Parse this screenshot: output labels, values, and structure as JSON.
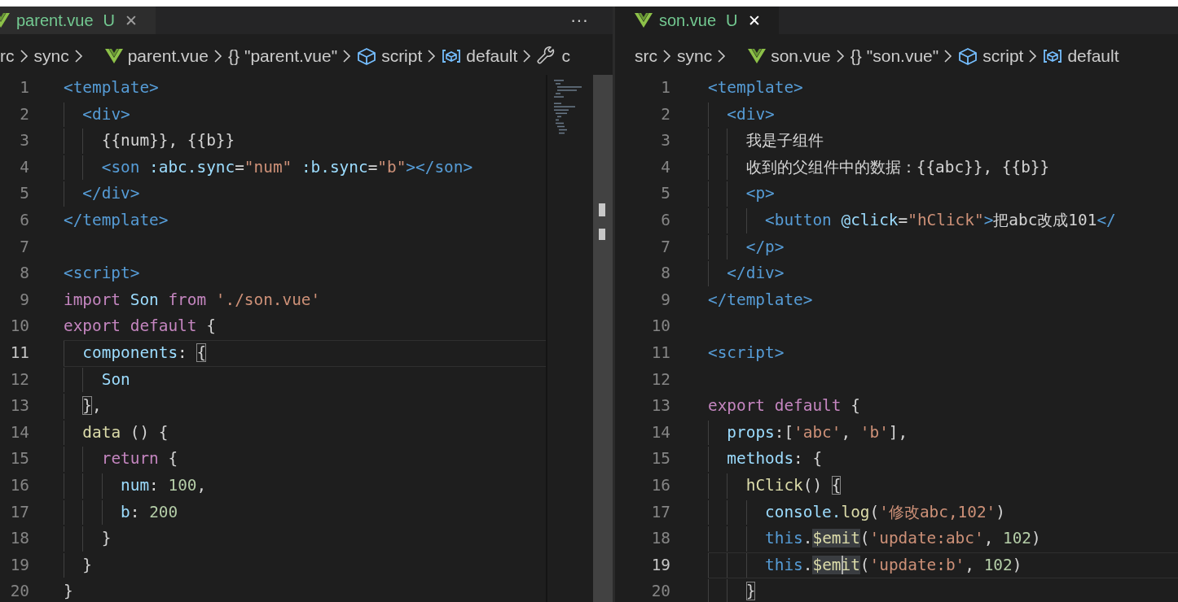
{
  "panes": [
    {
      "tab": {
        "label": "parent.vue",
        "badge": "U",
        "close": "✕",
        "selected": false
      },
      "more": "···",
      "breadcrumbs": [
        {
          "text": "rc",
          "kind": "folder"
        },
        {
          "text": "sync",
          "kind": "folder"
        },
        {
          "text": "parent.vue",
          "kind": "vue_file"
        },
        {
          "text": "\"parent.vue\"",
          "symbol": "{}",
          "kind": "module"
        },
        {
          "text": "script",
          "kind": "element"
        },
        {
          "text": "default",
          "kind": "variable"
        },
        {
          "text": "c",
          "kind": "property"
        }
      ],
      "lines": [
        {
          "number": "1",
          "current": false,
          "tokens": [
            {
              "text": "<template>",
              "kind": "tag"
            }
          ]
        },
        {
          "number": "2",
          "current": false,
          "tokens": [
            {
              "text": "  <div>",
              "kind": "tag"
            }
          ]
        },
        {
          "number": "3",
          "current": false,
          "tokens": [
            {
              "text": "    {{num}}, {{b}}",
              "kind": "text"
            }
          ]
        },
        {
          "number": "4",
          "current": false,
          "tokens": [
            {
              "text": "    <son",
              "kind": "tag"
            },
            {
              "text": " :abc.sync",
              "kind": "attr"
            },
            {
              "text": "=",
              "kind": "text"
            },
            {
              "text": "\"num\"",
              "kind": "string"
            },
            {
              "text": " :b.sync",
              "kind": "attr"
            },
            {
              "text": "=",
              "kind": "text"
            },
            {
              "text": "\"b\"",
              "kind": "string"
            },
            {
              "text": "></son>",
              "kind": "tag"
            }
          ]
        },
        {
          "number": "5",
          "current": false,
          "tokens": [
            {
              "text": "  </div>",
              "kind": "tag"
            }
          ]
        },
        {
          "number": "6",
          "current": false,
          "tokens": [
            {
              "text": "</template>",
              "kind": "tag"
            }
          ]
        },
        {
          "number": "7",
          "current": false
        },
        {
          "number": "8",
          "current": false,
          "tokens": [
            {
              "text": "<script>",
              "kind": "tag"
            }
          ]
        },
        {
          "number": "9",
          "current": false,
          "tokens": [
            {
              "text": "import",
              "kind": "keyword"
            },
            {
              "text": " Son ",
              "kind": "var"
            },
            {
              "text": "from ",
              "kind": "keyword"
            },
            {
              "text": "'./son.vue'",
              "kind": "string"
            }
          ]
        },
        {
          "number": "10",
          "current": false,
          "tokens": [
            {
              "text": "export default",
              "kind": "keyword"
            },
            {
              "text": " {",
              "kind": "text"
            }
          ]
        },
        {
          "number": "11",
          "current": true,
          "tokens": [
            {
              "text": "  components",
              "kind": "prop"
            },
            {
              "text": ": ",
              "kind": "text"
            },
            {
              "text": "{",
              "kind": "text",
              "boxed": true
            }
          ]
        },
        {
          "number": "12",
          "current": false,
          "tokens": [
            {
              "text": "    Son",
              "kind": "var"
            }
          ]
        },
        {
          "number": "13",
          "current": false,
          "tokens": [
            {
              "text": "  }",
              "kind": "text",
              "boxed": true
            },
            {
              "text": ",",
              "kind": "text"
            }
          ]
        },
        {
          "number": "14",
          "current": false,
          "tokens": [
            {
              "text": "  data",
              "kind": "func"
            },
            {
              "text": " () {",
              "kind": "text"
            }
          ]
        },
        {
          "number": "15",
          "current": false,
          "tokens": [
            {
              "text": "    return",
              "kind": "keyword"
            },
            {
              "text": " {",
              "kind": "text"
            }
          ]
        },
        {
          "number": "16",
          "current": false,
          "tokens": [
            {
              "text": "      num",
              "kind": "prop"
            },
            {
              "text": ": ",
              "kind": "text"
            },
            {
              "text": "100",
              "kind": "number"
            },
            {
              "text": ",",
              "kind": "text"
            }
          ]
        },
        {
          "number": "17",
          "current": false,
          "tokens": [
            {
              "text": "      b",
              "kind": "prop"
            },
            {
              "text": ": ",
              "kind": "text"
            },
            {
              "text": "200",
              "kind": "number"
            }
          ]
        },
        {
          "number": "18",
          "current": false,
          "tokens": [
            {
              "text": "    }",
              "kind": "text"
            }
          ]
        },
        {
          "number": "19",
          "current": false,
          "tokens": [
            {
              "text": "  }",
              "kind": "text"
            }
          ]
        },
        {
          "number": "20",
          "current": false,
          "tokens": [
            {
              "text": "}",
              "kind": "text"
            }
          ]
        }
      ]
    },
    {
      "tab": {
        "label": "son.vue",
        "badge": "U",
        "close": "✕",
        "selected": true
      },
      "breadcrumbs": [
        {
          "text": "src",
          "kind": "folder"
        },
        {
          "text": "sync",
          "kind": "folder"
        },
        {
          "text": "son.vue",
          "kind": "vue_file"
        },
        {
          "text": "\"son.vue\"",
          "symbol": "{}",
          "kind": "module"
        },
        {
          "text": "script",
          "kind": "element"
        },
        {
          "text": "default",
          "kind": "variable"
        }
      ],
      "lines": [
        {
          "number": "1",
          "current": false,
          "tokens": [
            {
              "text": "<template>",
              "kind": "tag"
            }
          ]
        },
        {
          "number": "2",
          "current": false,
          "tokens": [
            {
              "text": "  <div>",
              "kind": "tag"
            }
          ]
        },
        {
          "number": "3",
          "current": false,
          "tokens": [
            {
              "text": "    我是子组件",
              "kind": "text"
            }
          ]
        },
        {
          "number": "4",
          "current": false,
          "tokens": [
            {
              "text": "    收到的父组件中的数据：{{abc}}, {{b}}",
              "kind": "text"
            }
          ]
        },
        {
          "number": "5",
          "current": false,
          "tokens": [
            {
              "text": "    <p>",
              "kind": "tag"
            }
          ]
        },
        {
          "number": "6",
          "current": false,
          "tokens": [
            {
              "text": "      <button",
              "kind": "tag"
            },
            {
              "text": " @click",
              "kind": "attr"
            },
            {
              "text": "=",
              "kind": "text"
            },
            {
              "text": "\"hClick\"",
              "kind": "string"
            },
            {
              "text": ">",
              "kind": "tag"
            },
            {
              "text": "把abc改成101",
              "kind": "text"
            },
            {
              "text": "</",
              "kind": "tag"
            }
          ]
        },
        {
          "number": "7",
          "current": false,
          "tokens": [
            {
              "text": "    </p>",
              "kind": "tag"
            }
          ]
        },
        {
          "number": "8",
          "current": false,
          "tokens": [
            {
              "text": "  </div>",
              "kind": "tag"
            }
          ]
        },
        {
          "number": "9",
          "current": false,
          "tokens": [
            {
              "text": "</template>",
              "kind": "tag"
            }
          ]
        },
        {
          "number": "10",
          "current": false
        },
        {
          "number": "11",
          "current": false,
          "tokens": [
            {
              "text": "<script>",
              "kind": "tag"
            }
          ]
        },
        {
          "number": "12",
          "current": false
        },
        {
          "number": "13",
          "current": false,
          "tokens": [
            {
              "text": "export default",
              "kind": "keyword"
            },
            {
              "text": " {",
              "kind": "text"
            }
          ]
        },
        {
          "number": "14",
          "current": false,
          "tokens": [
            {
              "text": "  props",
              "kind": "prop"
            },
            {
              "text": ":[",
              "kind": "text"
            },
            {
              "text": "'abc'",
              "kind": "string"
            },
            {
              "text": ", ",
              "kind": "text"
            },
            {
              "text": "'b'",
              "kind": "string"
            },
            {
              "text": "],",
              "kind": "text"
            }
          ]
        },
        {
          "number": "15",
          "current": false,
          "tokens": [
            {
              "text": "  methods",
              "kind": "prop"
            },
            {
              "text": ": {",
              "kind": "text"
            }
          ]
        },
        {
          "number": "16",
          "current": false,
          "tokens": [
            {
              "text": "    hClick",
              "kind": "func"
            },
            {
              "text": "() ",
              "kind": "text"
            },
            {
              "text": "{",
              "kind": "text",
              "boxed": true
            }
          ]
        },
        {
          "number": "17",
          "current": false,
          "tokens": [
            {
              "text": "      console.",
              "kind": "prop"
            },
            {
              "text": "log",
              "kind": "func"
            },
            {
              "text": "(",
              "kind": "text"
            },
            {
              "text": "'修改abc,102'",
              "kind": "string"
            },
            {
              "text": ")",
              "kind": "text"
            }
          ]
        },
        {
          "number": "18",
          "current": false,
          "tokens": [
            {
              "text": "      this",
              "kind": "this"
            },
            {
              "text": ".",
              "kind": "text"
            },
            {
              "text": "$emit",
              "kind": "func",
              "highlight": true
            },
            {
              "text": "(",
              "kind": "text"
            },
            {
              "text": "'update:abc'",
              "kind": "string"
            },
            {
              "text": ", ",
              "kind": "text"
            },
            {
              "text": "102",
              "kind": "number"
            },
            {
              "text": ")",
              "kind": "text"
            }
          ]
        },
        {
          "number": "19",
          "current": true,
          "tokens": [
            {
              "text": "      this",
              "kind": "this"
            },
            {
              "text": ".",
              "kind": "text"
            },
            {
              "text": "$em",
              "kind": "func",
              "highlight": true
            },
            {
              "text": "it",
              "kind": "func",
              "highlight": true,
              "cursor_before": true
            },
            {
              "text": "(",
              "kind": "text"
            },
            {
              "text": "'update:b'",
              "kind": "string"
            },
            {
              "text": ", ",
              "kind": "text"
            },
            {
              "text": "102",
              "kind": "number"
            },
            {
              "text": ")",
              "kind": "text"
            }
          ]
        },
        {
          "number": "20",
          "current": false,
          "tokens": [
            {
              "text": "    }",
              "kind": "text",
              "boxed": true
            }
          ]
        }
      ]
    }
  ]
}
